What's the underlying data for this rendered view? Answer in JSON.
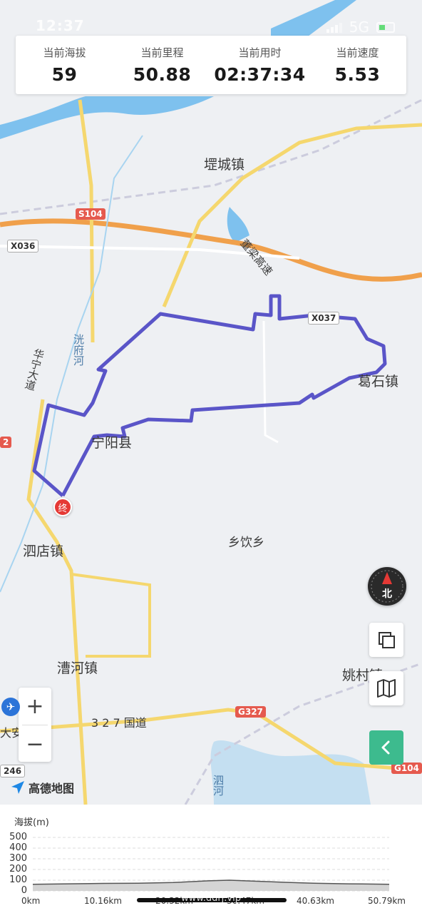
{
  "status_bar": {
    "time": "12:37",
    "network": "5G"
  },
  "stats": [
    {
      "label": "当前海拔",
      "value": "59"
    },
    {
      "label": "当前里程",
      "value": "50.88"
    },
    {
      "label": "当前用时",
      "value": "02:37:34"
    },
    {
      "label": "当前速度",
      "value": "5.53"
    }
  ],
  "map": {
    "places": {
      "pengcheng": "堽城镇",
      "gedian": "葛石镇",
      "ningyang": "宁阳县",
      "xiangyin": "乡饮乡",
      "sidian": "泗店镇",
      "caohe": "漕河镇",
      "yaocun": "姚村镇",
      "daan": "大安",
      "guangfuhe": "洸府河",
      "huaning": "华宁大道",
      "dongliang": "董梁高速",
      "guodao": "3 2 7 国道",
      "sihe": "泗河"
    },
    "roads": {
      "s104": "S104",
      "x036": "X036",
      "x037": "X037",
      "g327": "G327",
      "g104": "G104",
      "left_g": "2",
      "left_246": "246"
    },
    "end_marker": "终",
    "compass": "北",
    "logo": "高德地图",
    "colors": {
      "route": "#5a55c8",
      "highway": "#f0a04b",
      "road": "#f5d76e",
      "water": "#6fb6e8"
    }
  },
  "profile": {
    "title": "海拔(m)",
    "y_ticks": [
      "500",
      "400",
      "300",
      "200",
      "100",
      "0"
    ],
    "x_ticks": [
      "0km",
      "10.16km",
      "20.32km",
      "30.47km",
      "40.63km",
      "50.79km"
    ],
    "watermark": "www.ddrj.vip"
  },
  "chart_data": {
    "type": "area",
    "title": "",
    "xlabel": "",
    "ylabel": "海拔(m)",
    "ylim": [
      0,
      500
    ],
    "xlim": [
      0,
      50.79
    ],
    "x": [
      0,
      5,
      10,
      15,
      20,
      25,
      28,
      32,
      36,
      40,
      45,
      50.79
    ],
    "values": [
      62,
      66,
      70,
      72,
      78,
      94,
      100,
      90,
      80,
      72,
      66,
      62
    ]
  }
}
